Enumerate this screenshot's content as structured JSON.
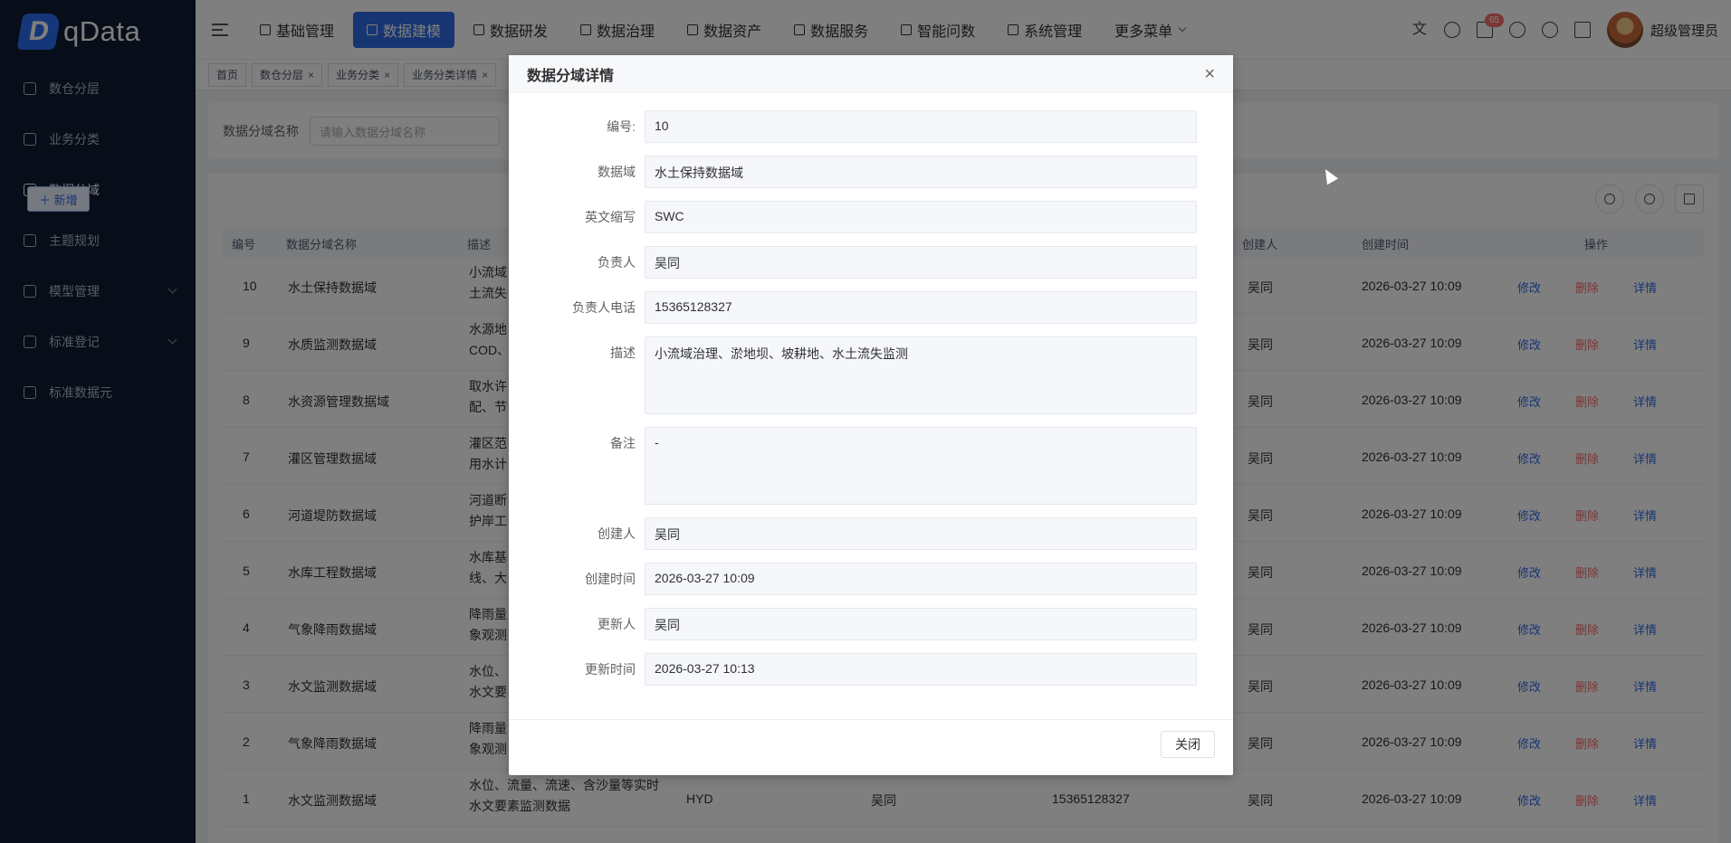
{
  "brand": {
    "logo_letter": "D",
    "name": "qData"
  },
  "sidebar": {
    "items": [
      {
        "label": "数仓分层",
        "active": false,
        "expandable": false
      },
      {
        "label": "业务分类",
        "active": false,
        "expandable": false
      },
      {
        "label": "数据分域",
        "active": true,
        "expandable": false
      },
      {
        "label": "主题规划",
        "active": false,
        "expandable": false
      },
      {
        "label": "模型管理",
        "active": false,
        "expandable": true
      },
      {
        "label": "标准登记",
        "active": false,
        "expandable": true
      },
      {
        "label": "标准数据元",
        "active": false,
        "expandable": false
      }
    ]
  },
  "header": {
    "nav": [
      {
        "label": "基础管理"
      },
      {
        "label": "数据建模",
        "active": true
      },
      {
        "label": "数据研发"
      },
      {
        "label": "数据治理"
      },
      {
        "label": "数据资产"
      },
      {
        "label": "数据服务"
      },
      {
        "label": "智能问数"
      },
      {
        "label": "系统管理"
      },
      {
        "label": "更多菜单"
      }
    ],
    "notification_count": "65",
    "username": "超级管理员"
  },
  "tags": [
    {
      "label": "首页",
      "closable": false
    },
    {
      "label": "数仓分层",
      "closable": true
    },
    {
      "label": "业务分类",
      "closable": true
    },
    {
      "label": "业务分类详情",
      "closable": true
    }
  ],
  "search": {
    "label": "数据分域名称",
    "placeholder": "请输入数据分域名称"
  },
  "toolbar": {
    "add_label": "＋ 新增"
  },
  "table": {
    "headers": {
      "id": "编号",
      "name": "数据分域名称",
      "desc": "描述",
      "creator": "创建人",
      "created": "创建时间",
      "ops": "操作"
    },
    "op_labels": {
      "edit": "修改",
      "delete": "删除",
      "view": "详情"
    },
    "rows": [
      {
        "id": "10",
        "name": "水土保持数据域",
        "desc1": "小流域",
        "desc2": "土流失",
        "abbr": "",
        "owner": "",
        "phone": "",
        "creator": "吴同",
        "created": "2026-03-27 10:09"
      },
      {
        "id": "9",
        "name": "水质监测数据域",
        "desc1": "水源地",
        "desc2": "COD、",
        "abbr": "",
        "owner": "",
        "phone": "",
        "creator": "吴同",
        "created": "2026-03-27 10:09"
      },
      {
        "id": "8",
        "name": "水资源管理数据域",
        "desc1": "取水许",
        "desc2": "配、节",
        "abbr": "",
        "owner": "",
        "phone": "",
        "creator": "吴同",
        "created": "2026-03-27 10:09"
      },
      {
        "id": "7",
        "name": "灌区管理数据域",
        "desc1": "灌区范",
        "desc2": "用水计",
        "abbr": "",
        "owner": "",
        "phone": "",
        "creator": "吴同",
        "created": "2026-03-27 10:09"
      },
      {
        "id": "6",
        "name": "河道堤防数据域",
        "desc1": "河道断",
        "desc2": "护岸工",
        "abbr": "",
        "owner": "",
        "phone": "",
        "creator": "吴同",
        "created": "2026-03-27 10:09"
      },
      {
        "id": "5",
        "name": "水库工程数据域",
        "desc1": "水库基",
        "desc2": "线、大",
        "abbr": "",
        "owner": "",
        "phone": "",
        "creator": "吴同",
        "created": "2026-03-27 10:09"
      },
      {
        "id": "4",
        "name": "气象降雨数据域",
        "desc1": "降雨量",
        "desc2": "象观测",
        "abbr": "",
        "owner": "",
        "phone": "",
        "creator": "吴同",
        "created": "2026-03-27 10:09"
      },
      {
        "id": "3",
        "name": "水文监测数据域",
        "desc1": "水位、",
        "desc2": "水文要",
        "abbr": "",
        "owner": "",
        "phone": "",
        "creator": "吴同",
        "created": "2026-03-27 10:09"
      },
      {
        "id": "2",
        "name": "气象降雨数据域",
        "desc1": "降雨量",
        "desc2": "象观测",
        "abbr": "",
        "owner": "",
        "phone": "",
        "creator": "吴同",
        "created": "2026-03-27 10:09"
      },
      {
        "id": "1",
        "name": "水文监测数据域",
        "desc1": "水位、流量、流速、含沙量等实时",
        "desc2": "水文要素监测数据",
        "abbr": "HYD",
        "owner": "吴同",
        "phone": "15365128327",
        "creator": "吴同",
        "created": "2026-03-27 10:09"
      }
    ]
  },
  "dialog": {
    "title": "数据分域详情",
    "close_icon": "×",
    "fields": [
      {
        "label": "编号:",
        "value": "10",
        "tall": false
      },
      {
        "label": "数据域",
        "value": "水土保持数据域",
        "tall": false
      },
      {
        "label": "英文缩写",
        "value": "SWC",
        "tall": false
      },
      {
        "label": "负责人",
        "value": "吴同",
        "tall": false
      },
      {
        "label": "负责人电话",
        "value": "15365128327",
        "tall": false
      },
      {
        "label": "描述",
        "value": "小流域治理、淤地坝、坡耕地、水土流失监测",
        "tall": true
      },
      {
        "label": "备注",
        "value": "-",
        "tall": true
      },
      {
        "label": "创建人",
        "value": "吴同",
        "tall": false
      },
      {
        "label": "创建时间",
        "value": "2026-03-27 10:09",
        "tall": false
      },
      {
        "label": "更新人",
        "value": "吴同",
        "tall": false
      },
      {
        "label": "更新时间",
        "value": "2026-03-27 10:13",
        "tall": false
      }
    ],
    "close_button": "关闭"
  },
  "colors": {
    "accent": "#2f6ae5",
    "sidebar_bg": "#0f1b33",
    "danger": "#f56c6c"
  }
}
